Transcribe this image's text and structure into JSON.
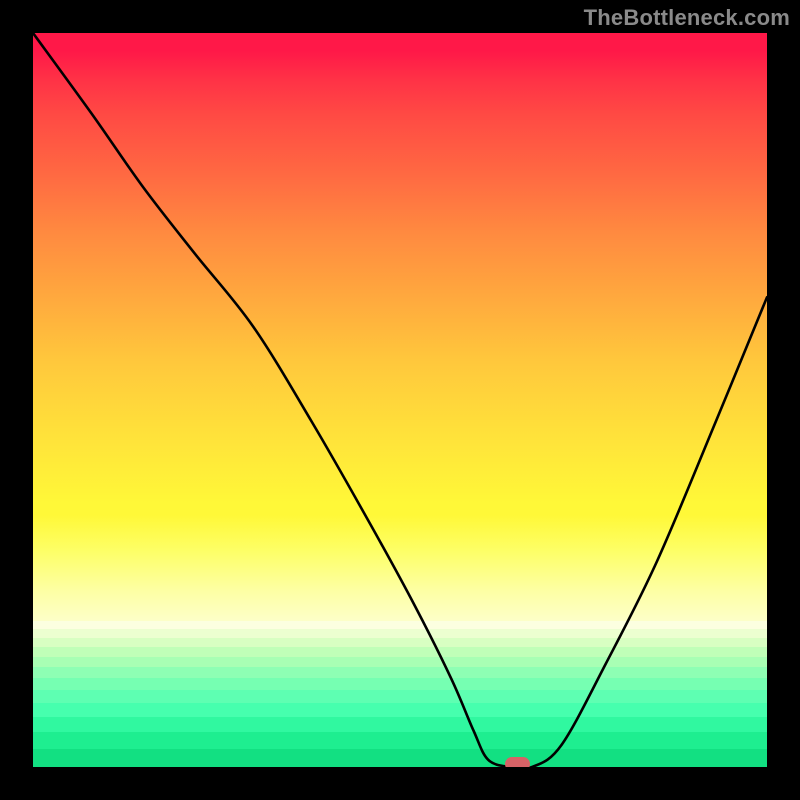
{
  "watermark": "TheBottleneck.com",
  "chart_data": {
    "type": "line",
    "title": "",
    "xlabel": "",
    "ylabel": "",
    "xlim": [
      0,
      100
    ],
    "ylim": [
      0,
      100
    ],
    "x": [
      0,
      8,
      15,
      22,
      30,
      38,
      46,
      52,
      57,
      60,
      62,
      65,
      68,
      72,
      78,
      85,
      93,
      100
    ],
    "values": [
      100,
      89,
      79,
      70,
      60,
      47,
      33,
      22,
      12,
      5,
      1,
      0,
      0,
      3,
      14,
      28,
      47,
      64
    ],
    "marker": {
      "x": 66,
      "y": 0
    },
    "gradient_stops": [
      {
        "pos": 0.0,
        "color": "#ff1848"
      },
      {
        "pos": 0.24,
        "color": "#ff6942"
      },
      {
        "pos": 0.5,
        "color": "#ffc83c"
      },
      {
        "pos": 0.72,
        "color": "#fff838"
      },
      {
        "pos": 0.8,
        "color": "#fdffc8"
      },
      {
        "pos": 0.805,
        "color": "#fcffe0"
      },
      {
        "pos": 0.815,
        "color": "#e0ffca"
      },
      {
        "pos": 0.83,
        "color": "#c4ffb6"
      },
      {
        "pos": 0.848,
        "color": "#9effae"
      },
      {
        "pos": 0.868,
        "color": "#7effb2"
      },
      {
        "pos": 0.892,
        "color": "#5effb2"
      },
      {
        "pos": 0.92,
        "color": "#40ffae"
      },
      {
        "pos": 0.955,
        "color": "#22f096"
      },
      {
        "pos": 1.0,
        "color": "#12e082"
      }
    ]
  }
}
